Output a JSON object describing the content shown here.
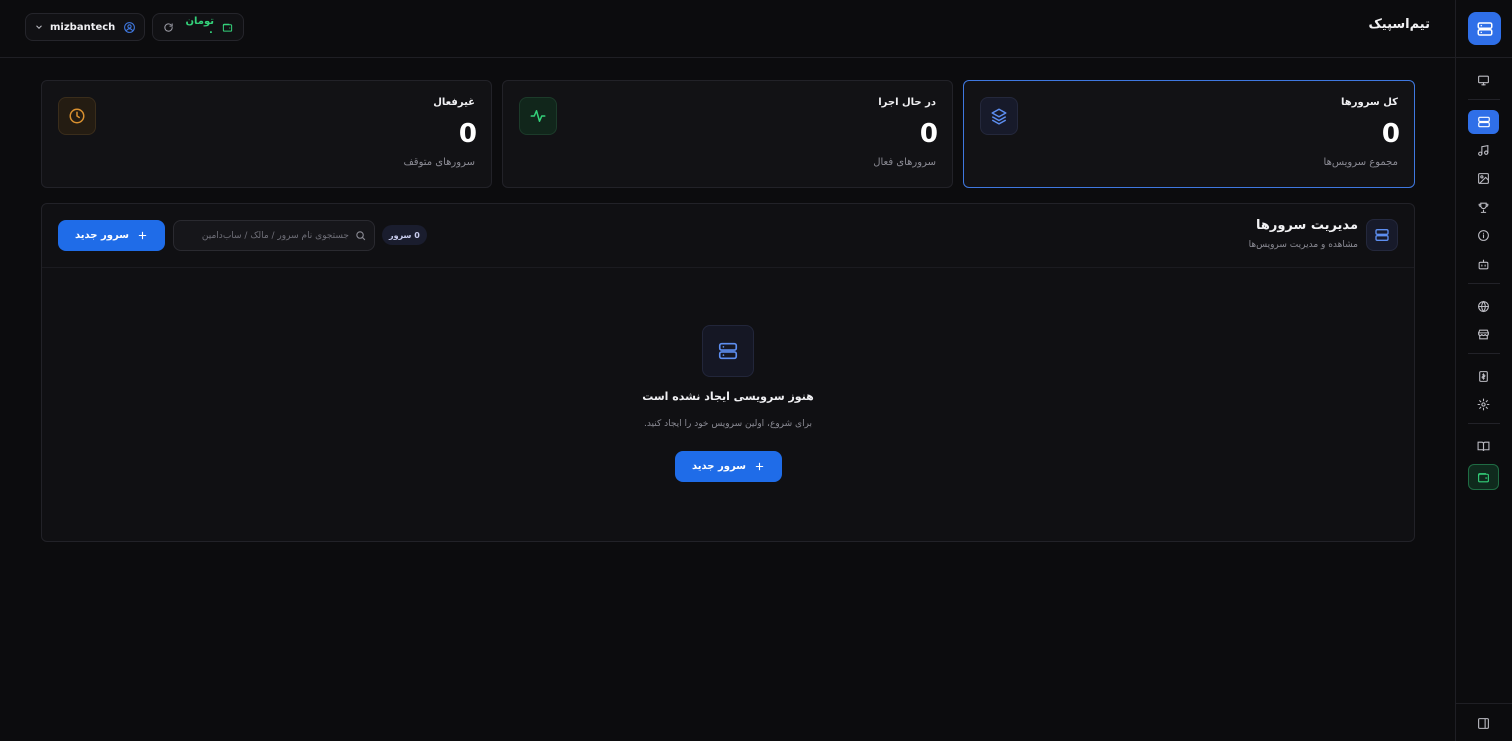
{
  "header": {
    "brand": "تیم‌اسپیک",
    "username": "mizbantech",
    "wallet_amount": "تومان ۰"
  },
  "stats": [
    {
      "title": "کل سرورها",
      "value": "0",
      "subtitle": "مجموع سرویس‌ها",
      "icon": "layers-icon",
      "color": "#3f78e0"
    },
    {
      "title": "در حال اجرا",
      "value": "0",
      "subtitle": "سرورهای فعال",
      "icon": "activity-icon",
      "color": "#34d17a"
    },
    {
      "title": "غیرفعال",
      "value": "0",
      "subtitle": "سرورهای متوقف",
      "icon": "clock-icon",
      "color": "#d9902f"
    }
  ],
  "panel": {
    "title": "مدیریت سرورها",
    "subtitle": "مشاهده و مدیریت سرویس‌ها",
    "count_badge": "0 سرور",
    "search_placeholder": "جستجوی نام سرور / مالک / ساب‌دامین",
    "new_button": "سرور جدید",
    "empty_title": "هنوز سرویسی ایجاد نشده است",
    "empty_subtitle": "برای شروع، اولین سرویس خود را ایجاد کنید."
  },
  "sidebar": {
    "items": [
      {
        "name": "monitor-icon",
        "active": false
      },
      {
        "name": "server-icon",
        "active": true
      },
      {
        "name": "music-icon",
        "active": false
      },
      {
        "name": "image-icon",
        "active": false
      },
      {
        "name": "trophy-icon",
        "active": false
      },
      {
        "name": "info-icon",
        "active": false
      },
      {
        "name": "bot-icon",
        "active": false
      },
      {
        "name": "globe-icon",
        "active": false
      },
      {
        "name": "store-icon",
        "active": false
      },
      {
        "name": "invoice-icon",
        "active": false
      },
      {
        "name": "settings-icon",
        "active": false
      },
      {
        "name": "book-icon",
        "active": false
      },
      {
        "name": "wallet-icon",
        "active": false
      }
    ]
  },
  "colors": {
    "accent": "#1f6ce8",
    "success": "#34d17a",
    "warning": "#d9902f"
  }
}
